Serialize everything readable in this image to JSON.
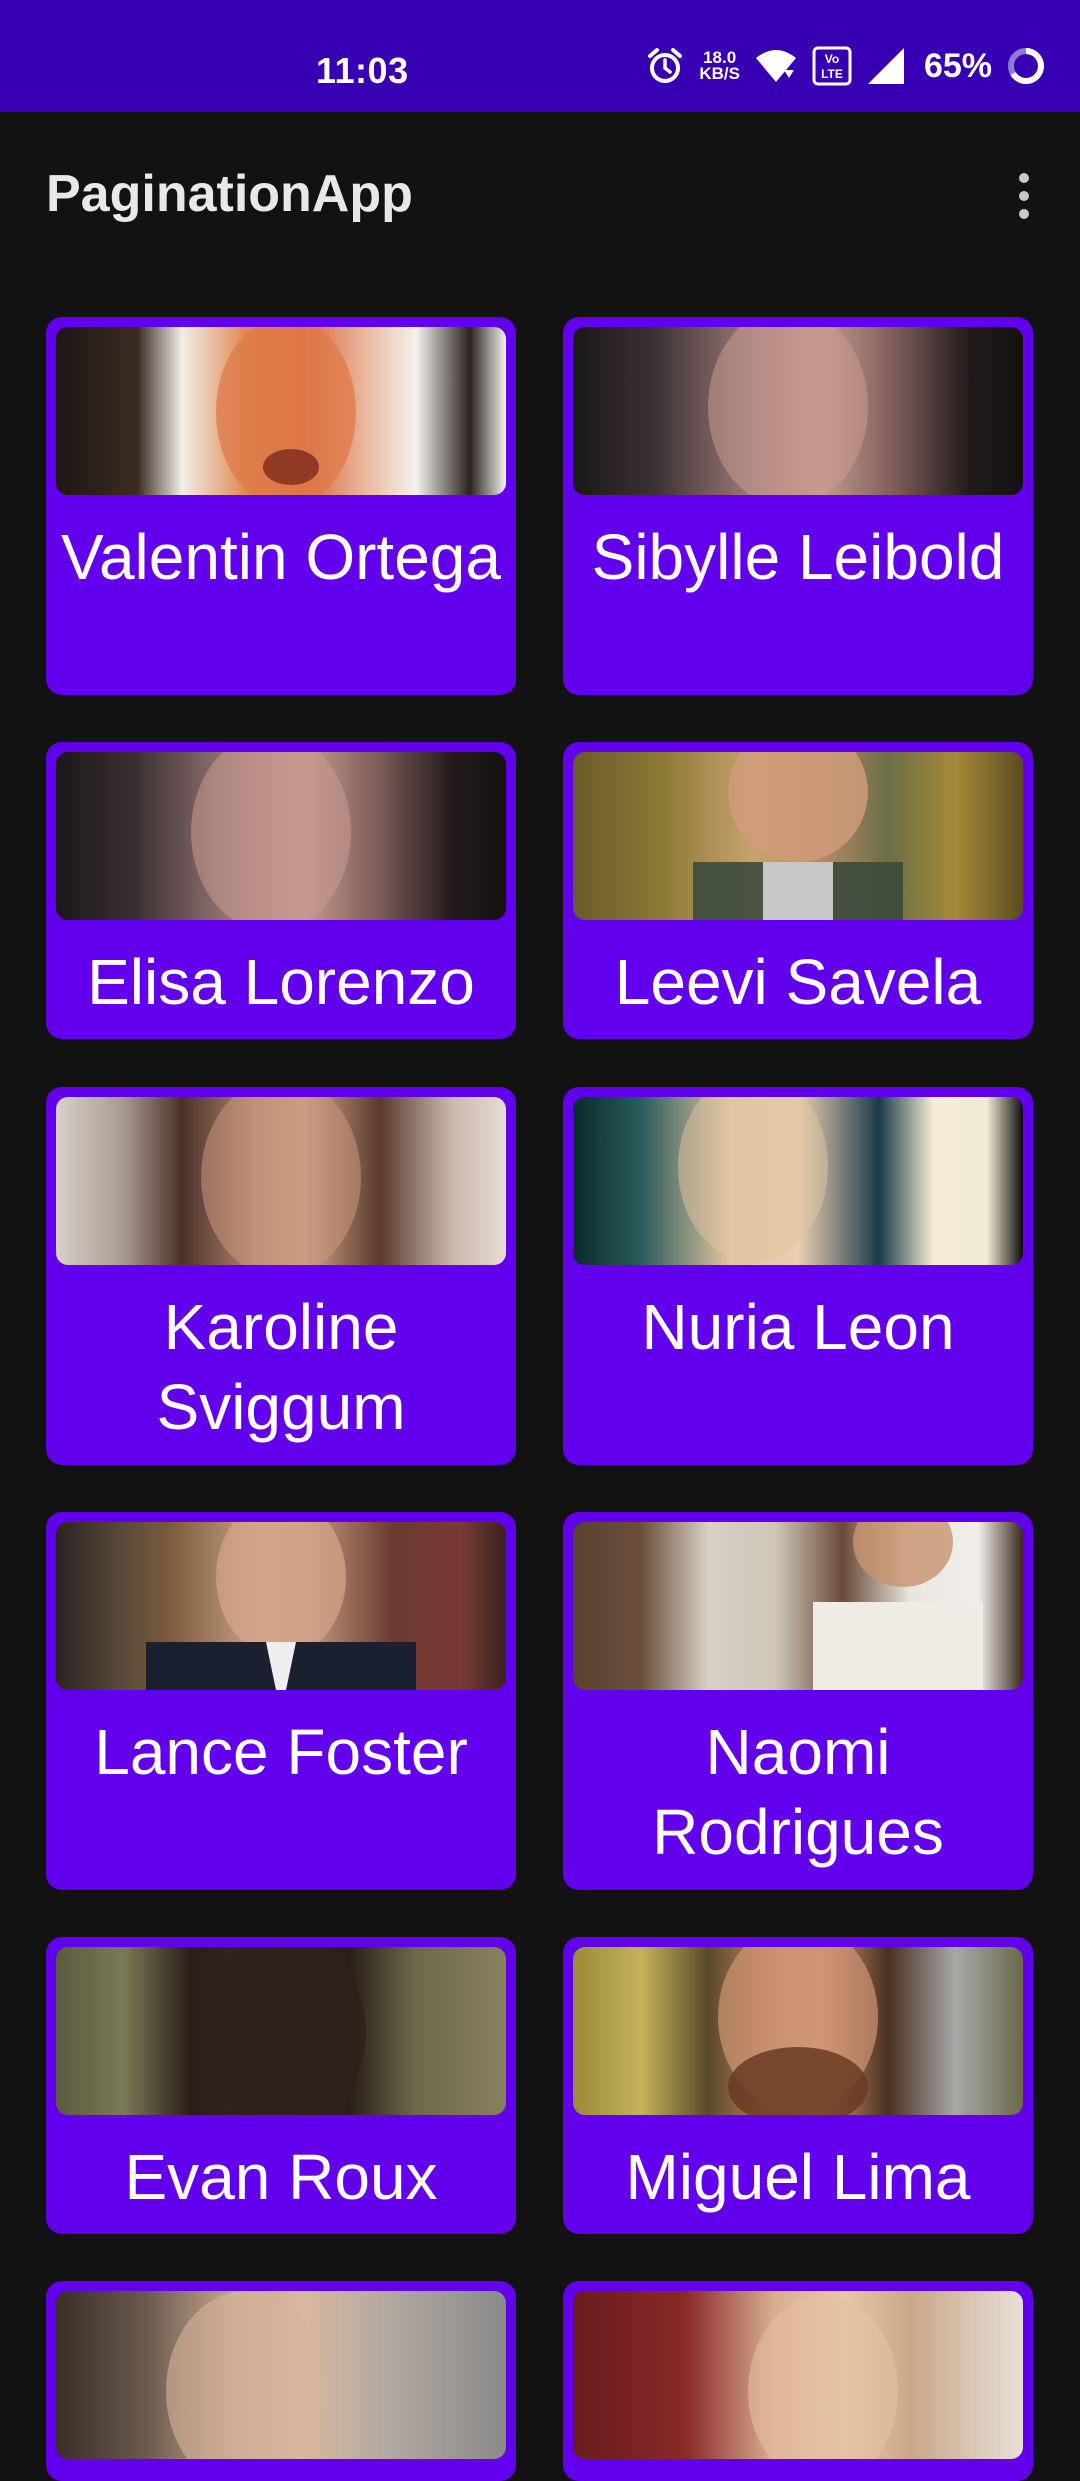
{
  "status_bar": {
    "time": "11:03",
    "net_speed_value": "18.0",
    "net_speed_unit": "KB/S",
    "volte": "Vo LTE",
    "battery": "65%",
    "icons": [
      "alarm-icon",
      "wifi-icon",
      "volte-icon",
      "signal-icon",
      "battery-ring-icon"
    ]
  },
  "app_bar": {
    "title": "PaginationApp",
    "menu_icon": "more-vert-icon"
  },
  "colors": {
    "status_bar": "#3700B3",
    "card": "#6200EE",
    "background": "#121212"
  },
  "users": [
    {
      "name": "Valentin Ortega"
    },
    {
      "name": "Sibylle Leibold"
    },
    {
      "name": "Elisa Lorenzo"
    },
    {
      "name": "Leevi Savela"
    },
    {
      "name": "Karoline Sviggum"
    },
    {
      "name": "Nuria Leon"
    },
    {
      "name": "Lance Foster"
    },
    {
      "name": "Naomi Rodrigues"
    },
    {
      "name": "Evan Roux"
    },
    {
      "name": "Miguel Lima"
    },
    {
      "name": ""
    },
    {
      "name": ""
    }
  ]
}
